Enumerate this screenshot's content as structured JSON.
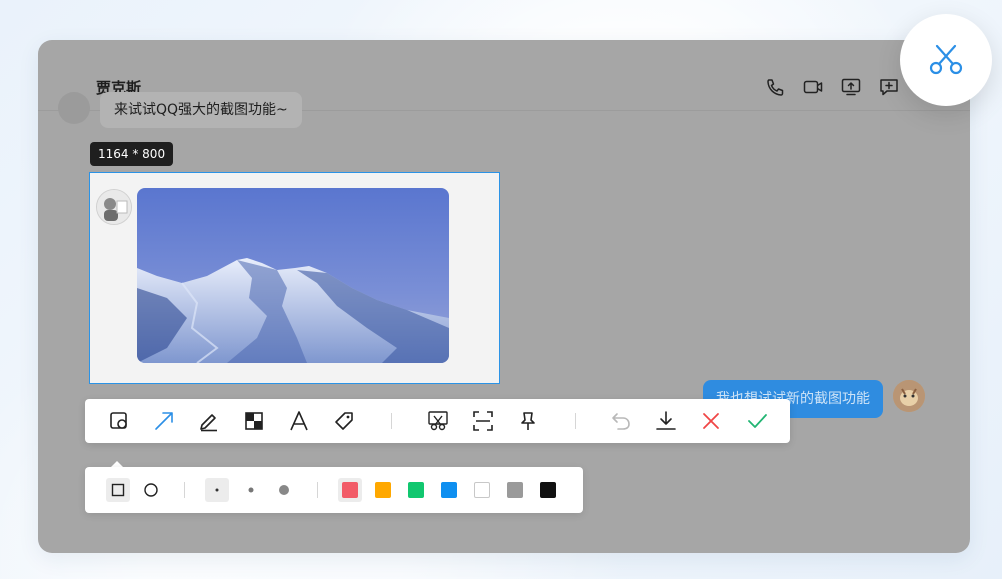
{
  "chat": {
    "contact_name": "贾克斯",
    "incoming_message": "来试试QQ强大的截图功能~",
    "outgoing_message": "我也想试试新的截图功能"
  },
  "header_icons": [
    "phone-icon",
    "video-call-icon",
    "screen-share-icon",
    "add-chat-icon"
  ],
  "screenshot": {
    "size_label": "1164 * 800"
  },
  "toolbar": {
    "tools": [
      "shape-tool-icon",
      "arrow-tool-icon",
      "pen-tool-icon",
      "mosaic-tool-icon",
      "text-tool-icon",
      "tag-tool-icon",
      "scissors-icon",
      "scan-icon",
      "pin-icon",
      "undo-icon",
      "download-icon",
      "cancel-icon",
      "confirm-icon"
    ],
    "active_tool": "shape-tool-icon"
  },
  "shape_options": {
    "shapes": [
      "rectangle",
      "circle"
    ],
    "selected_shape": "rectangle",
    "stroke_sizes": [
      "small",
      "medium",
      "large"
    ],
    "selected_size": "small",
    "colors": [
      "#f25b67",
      "#ffa800",
      "#11c76f",
      "#0e8ff0",
      "#ffffff",
      "#9a9a9a",
      "#111111"
    ],
    "selected_color": "#f25b67"
  },
  "colors": {
    "accent": "#2b93e6",
    "confirm": "#22b573",
    "cancel": "#f04646"
  }
}
